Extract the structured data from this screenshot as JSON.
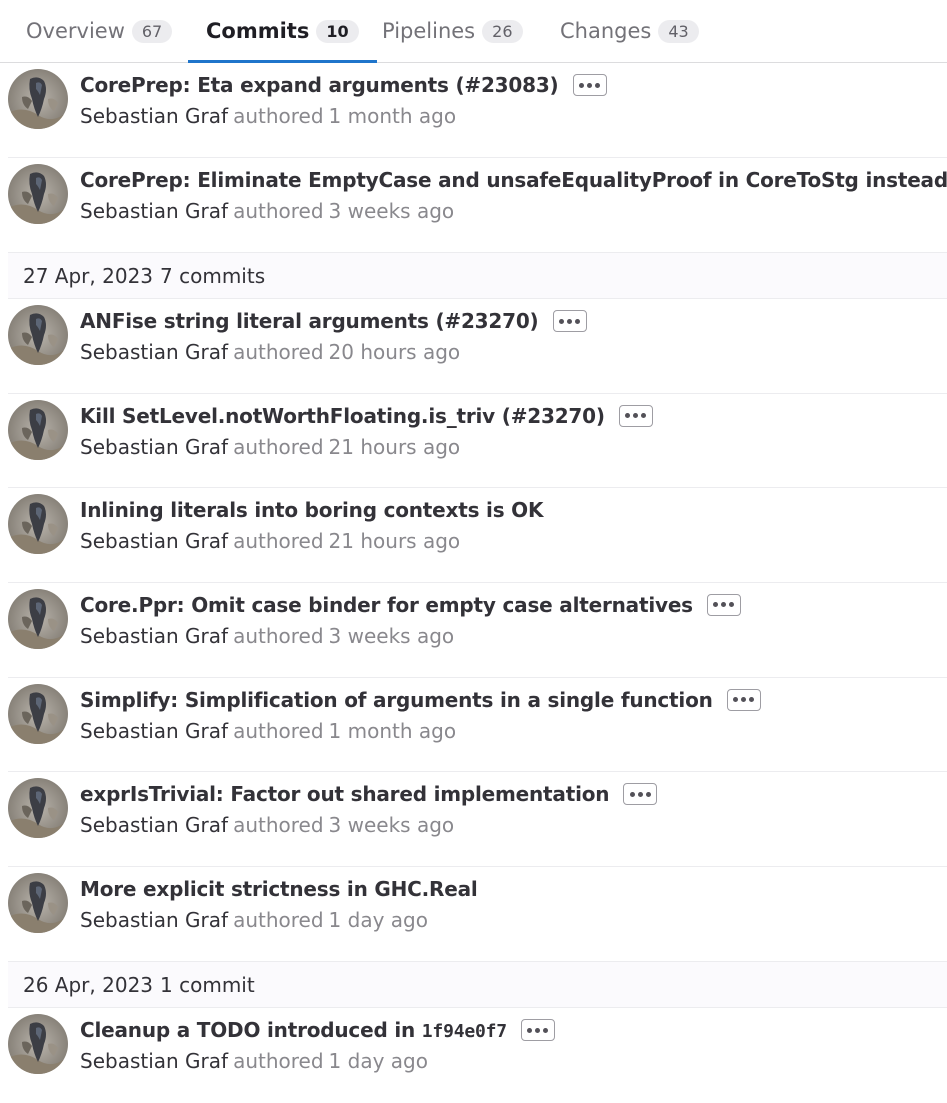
{
  "tabs": [
    {
      "label": "Overview",
      "count": "67"
    },
    {
      "label": "Commits",
      "count": "10"
    },
    {
      "label": "Pipelines",
      "count": "26"
    },
    {
      "label": "Changes",
      "count": "43"
    }
  ],
  "groups": {
    "g1": {
      "commits": [
        {
          "title": "CorePrep: Eta expand arguments (#23083)",
          "author": "Sebastian Graf",
          "authored": "authored",
          "time": "1 month ago"
        },
        {
          "title": "CorePrep: Eliminate EmptyCase and unsafeEqualityProof in CoreToStg instead",
          "author": "Sebastian Graf",
          "authored": "authored",
          "time": "3 weeks ago"
        }
      ]
    },
    "g2": {
      "date": "27 Apr, 2023",
      "count": "7 commits",
      "commits": [
        {
          "title": "ANFise string literal arguments (#23270)",
          "author": "Sebastian Graf",
          "authored": "authored",
          "time": "20 hours ago"
        },
        {
          "title": "Kill SetLevel.notWorthFloating.is_triv (#23270)",
          "author": "Sebastian Graf",
          "authored": "authored",
          "time": "21 hours ago"
        },
        {
          "title": "Inlining literals into boring contexts is OK",
          "author": "Sebastian Graf",
          "authored": "authored",
          "time": "21 hours ago"
        },
        {
          "title": "Core.Ppr: Omit case binder for empty case alternatives",
          "author": "Sebastian Graf",
          "authored": "authored",
          "time": "3 weeks ago"
        },
        {
          "title": "Simplify: Simplification of arguments in a single function",
          "author": "Sebastian Graf",
          "authored": "authored",
          "time": "1 month ago"
        },
        {
          "title": "exprIsTrivial: Factor out shared implementation",
          "author": "Sebastian Graf",
          "authored": "authored",
          "time": "3 weeks ago"
        },
        {
          "title": "More explicit strictness in GHC.Real",
          "author": "Sebastian Graf",
          "authored": "authored",
          "time": "1 day ago"
        }
      ]
    },
    "g3": {
      "date": "26 Apr, 2023",
      "count": "1 commit",
      "commits": [
        {
          "title_prefix": "Cleanup a TODO introduced in",
          "title_sha": "1f94e0f7",
          "author": "Sebastian Graf",
          "authored": "authored",
          "time": "1 day ago"
        }
      ]
    }
  },
  "colors": {
    "accent": "#1f75cb",
    "muted_text": "#89888d",
    "primary_text": "#333238"
  },
  "icons": {
    "avatar": "user-avatar",
    "more": "ellipsis-icon"
  }
}
